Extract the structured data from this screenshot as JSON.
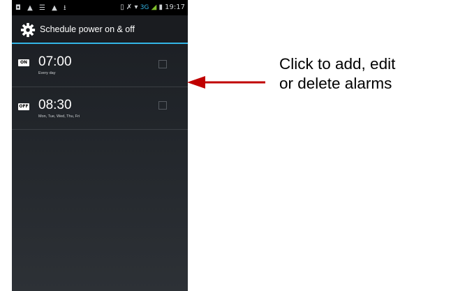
{
  "status_bar": {
    "left_icons": "◘ ▲ ☰ ▲ ⭳",
    "right_icons": "▯ ✗ ▾",
    "network": "3G",
    "signal": "◢",
    "battery": "▮",
    "time": "19:17"
  },
  "action_bar": {
    "title": "Schedule power on & off",
    "icon": "gear-icon"
  },
  "schedules": [
    {
      "badge": "ON",
      "time": "07:00",
      "days": "Every day",
      "checked": false
    },
    {
      "badge": "OFF",
      "time": "08:30",
      "days": "Mon, Tue, Wed, Thu, Fri",
      "checked": false
    }
  ],
  "annotation": {
    "line1": "Click to add, edit",
    "line2": "or delete alarms",
    "arrow_color": "#c00000"
  },
  "colors": {
    "accent": "#33b5e5",
    "background": "#22262b"
  }
}
